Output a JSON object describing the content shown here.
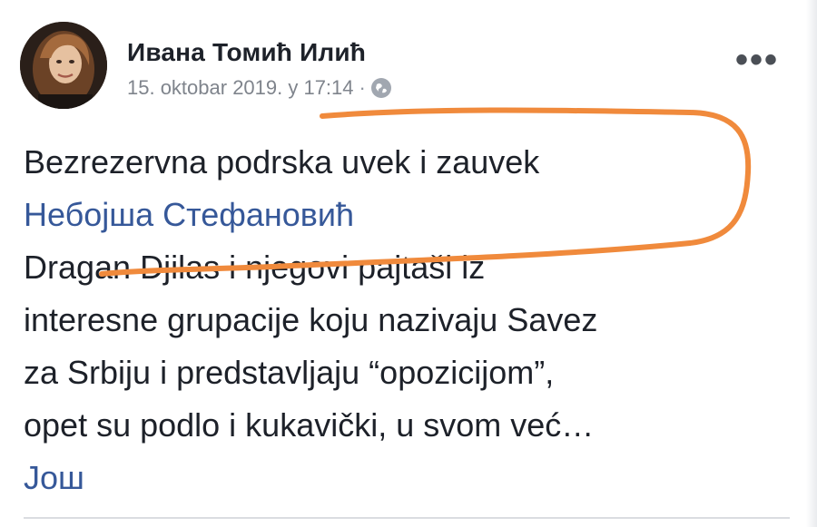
{
  "post": {
    "author_name": "Ивана Томић Илић",
    "timestamp": "15. oktobar 2019. у 17:14",
    "separator": "·",
    "privacy_icon": "globe-icon",
    "more_label": "•••",
    "text_line_1": "Bezrezervna podrska uvek i zauvek",
    "mention": "Небојша Стефановић",
    "text_line_3": "Dragan Djilas i njegovi pajtaši iz",
    "text_line_4": "interesne grupacije koju nazivaju Savez",
    "text_line_5": "za Srbiju i predstavljaju “opozicijom”,",
    "text_line_6": "opet su podlo i kukavički, u svom već…",
    "see_more": "Још"
  },
  "colors": {
    "link": "#365899",
    "text": "#1d2129",
    "meta": "#7f848c",
    "annotation": "#f08a3c"
  }
}
